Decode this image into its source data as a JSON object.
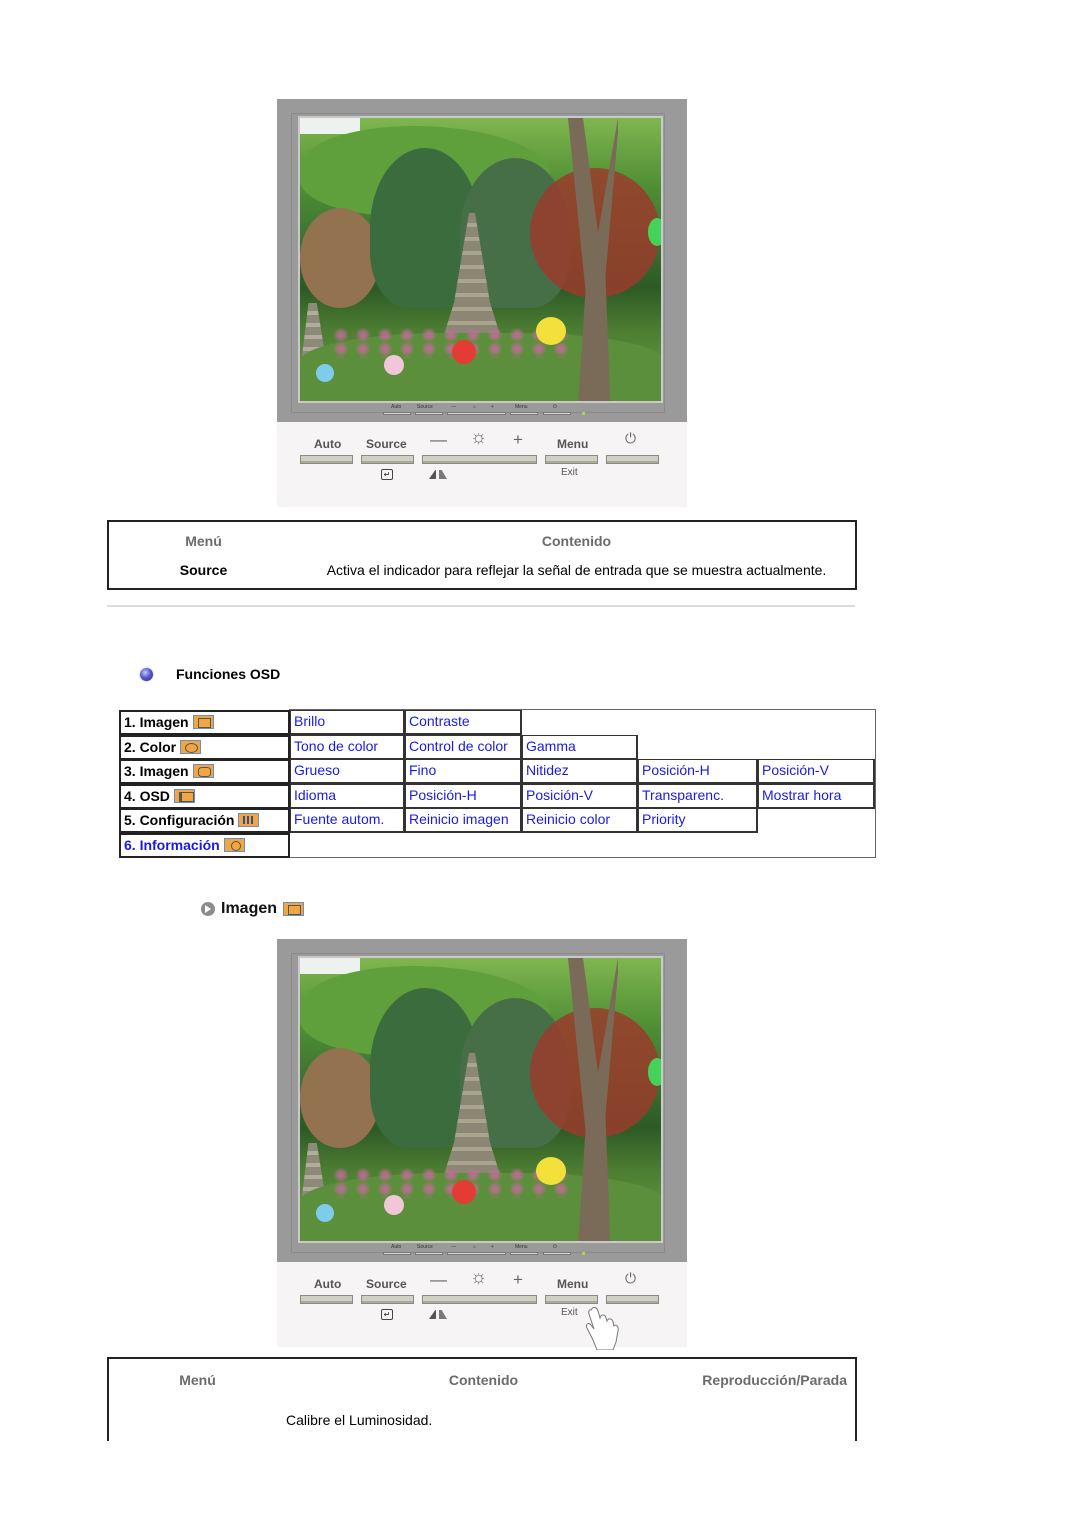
{
  "monitor": {
    "mini_labels": [
      "Auto",
      "Source",
      "—",
      "☼",
      "+",
      "Menu",
      "⏻"
    ],
    "buttons": {
      "auto": "Auto",
      "source": "Source",
      "minus": "—",
      "brightness": "☼",
      "plus": "+",
      "menu": "Menu",
      "power": "⏻",
      "exit": "Exit",
      "enter": "↵"
    }
  },
  "table1": {
    "header_menu": "Menú",
    "header_content": "Contenido",
    "rows": [
      {
        "menu": "Source",
        "content": "Activa el indicador para reflejar la señal de entrada que se muestra actualmente."
      }
    ]
  },
  "osd": {
    "title": "Funciones OSD",
    "menus": [
      {
        "label": "1. Imagen",
        "icon": "picture-icon",
        "items": [
          "Brillo",
          "Contraste"
        ]
      },
      {
        "label": "2. Color",
        "icon": "color-icon",
        "items": [
          "Tono de color",
          "Control de color",
          "Gamma"
        ]
      },
      {
        "label": "3. Imagen",
        "icon": "position-icon",
        "items": [
          "Grueso",
          "Fino",
          "Nitidez",
          "Posición-H",
          "Posición-V"
        ]
      },
      {
        "label": "4. OSD",
        "icon": "osd-icon",
        "items": [
          "Idioma",
          "Posición-H",
          "Posición-V",
          "Transparenc.",
          "Mostrar hora"
        ]
      },
      {
        "label": "5. Configuración",
        "icon": "setup-icon",
        "items": [
          "Fuente autom.",
          "Reinicio imagen",
          "Reinicio color",
          "Priority"
        ]
      },
      {
        "label": "6. Información",
        "icon": "info-icon",
        "items": []
      }
    ],
    "link_color": "#1a1ae6"
  },
  "section": {
    "title": "Imagen"
  },
  "table2": {
    "header_menu": "Menú",
    "header_content": "Contenido",
    "header_play": "Reproducción/Parada",
    "rows": [
      {
        "menu": "",
        "content": "Calibre el Luminosidad.",
        "play": ""
      }
    ]
  }
}
